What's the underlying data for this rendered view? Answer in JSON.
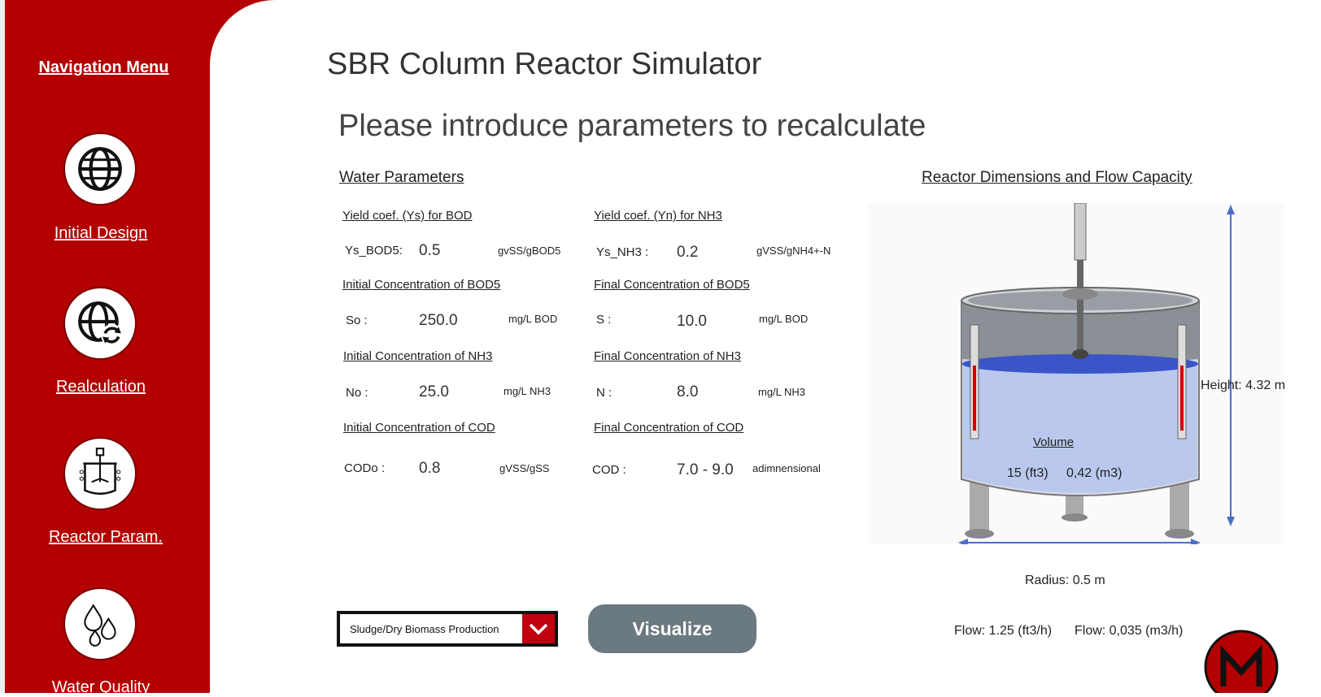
{
  "sidebar": {
    "title": "Navigation Menu",
    "items": [
      {
        "label": "Initial Design",
        "icon": "globe-icon"
      },
      {
        "label": "Realculation",
        "icon": "globe-refresh-icon"
      },
      {
        "label": "Reactor Param.",
        "icon": "reactor-icon"
      },
      {
        "label": "Water Quality",
        "icon": "water-drops-icon"
      }
    ]
  },
  "header": {
    "title": "SBR Column Reactor Simulator",
    "subtitle": "Please introduce parameters to recalculate"
  },
  "water_params": {
    "heading": "Water Parameters",
    "ys_heading": "Yield coef. (Ys) for BOD",
    "ys_label": "Ys_BOD5:",
    "ys_value": "0.5",
    "ys_unit": "gvSS/gBOD5",
    "yn_heading": "Yield coef. (Yn) for NH3",
    "yn_label": "Ys_NH3 :",
    "yn_value": "0.2",
    "yn_unit": "gVSS/gNH4+-N",
    "bod_init_heading": "Initial Concentration of BOD5",
    "so_label": "So :",
    "so_value": "250.0",
    "so_unit": "mg/L BOD",
    "bod_final_heading": "Final Concentration of BOD5",
    "s_label": "S :",
    "s_value": "10.0",
    "s_unit": "mg/L BOD",
    "nh3_init_heading": "Initial Concentration of NH3",
    "no_label": "No :",
    "no_value": "25.0",
    "no_unit": "mg/L NH3",
    "nh3_final_heading": "Final Concentration of NH3",
    "n_label": "N :",
    "n_value": "8.0",
    "n_unit": "mg/L NH3",
    "cod_init_heading": "Initial Concentration of COD",
    "codo_label": "CODo :",
    "codo_value": "0.8",
    "codo_unit": "gVSS/gSS",
    "cod_final_heading": "Final Concentration of COD",
    "cod_label": "COD :",
    "cod_value": "7.0 - 9.0",
    "cod_unit": "adimnensional"
  },
  "reactor": {
    "heading": "Reactor Dimensions and Flow Capacity",
    "volume_label": "Volume",
    "volume_ft3": "15 (ft3)",
    "volume_m3": "0,42 (m3)",
    "height": "Height: 4.32 m",
    "radius": "Radius: 0.5 m",
    "flow_ft3": "Flow: 1.25 (ft3/h)",
    "flow_m3": "Flow: 0,035 (m3/h)"
  },
  "controls": {
    "dropdown_value": "Sludge/Dry Biomass Production",
    "visualize_label": "Visualize"
  },
  "colors": {
    "sidebar": "#b30000",
    "button": "#6b7a80",
    "dropdown_accent": "#c00010",
    "water": "#aabbee"
  }
}
